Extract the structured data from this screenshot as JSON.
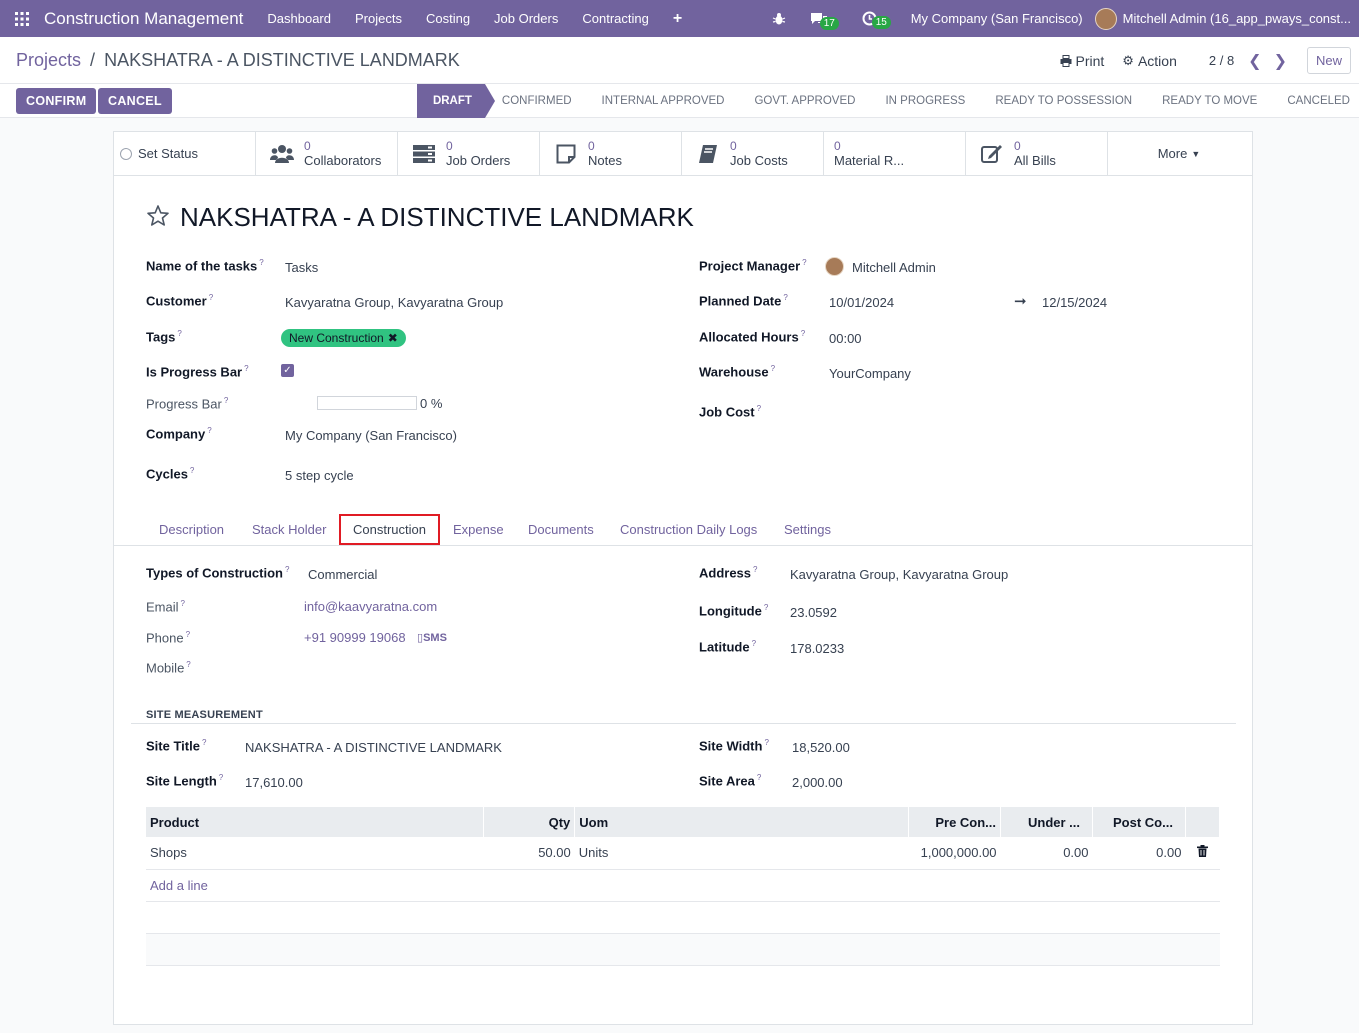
{
  "navbar": {
    "app_name": "Construction Management",
    "menu": [
      "Dashboard",
      "Projects",
      "Costing",
      "Job Orders",
      "Contracting"
    ],
    "messages_count": "17",
    "activities_count": "15",
    "company": "My Company (San Francisco)",
    "user": "Mitchell Admin (16_app_pways_const..."
  },
  "control_panel": {
    "breadcrumb_parent": "Projects",
    "breadcrumb_sep": "/",
    "record_name": "NAKSHATRA - A DISTINCTIVE LANDMARK",
    "print_label": "Print",
    "action_label": "Action",
    "pager": "2 / 8",
    "new_label": "New"
  },
  "statusbar": {
    "confirm_label": "CONFIRM",
    "cancel_label": "CANCEL",
    "stages": [
      "DRAFT",
      "CONFIRMED",
      "INTERNAL APPROVED",
      "GOVT. APPROVED",
      "IN PROGRESS",
      "READY TO POSSESSION",
      "READY TO MOVE",
      "CANCELED"
    ],
    "active_stage": "DRAFT"
  },
  "smart_buttons": {
    "set_status": "Set Status",
    "collaborators": {
      "count": "0",
      "label": "Collaborators"
    },
    "job_orders": {
      "count": "0",
      "label": "Job Orders"
    },
    "notes": {
      "count": "0",
      "label": "Notes"
    },
    "job_costs": {
      "count": "0",
      "label": "Job Costs"
    },
    "material": {
      "count": "0",
      "label": "Material R..."
    },
    "all_bills": {
      "count": "0",
      "label": "All Bills"
    },
    "more": "More"
  },
  "form": {
    "title": "NAKSHATRA - A DISTINCTIVE LANDMARK",
    "labels": {
      "task_name": "Name of the tasks",
      "customer": "Customer",
      "tags": "Tags",
      "is_progress": "Is Progress Bar",
      "progress_bar": "Progress Bar",
      "company": "Company",
      "cycles": "Cycles",
      "project_manager": "Project Manager",
      "planned_date": "Planned Date",
      "allocated_hours": "Allocated Hours",
      "warehouse": "Warehouse",
      "job_cost": "Job Cost"
    },
    "values": {
      "task_name": "Tasks",
      "customer": "Kavyaratna Group, Kavyaratna Group",
      "tag": "New Construction",
      "is_progress": true,
      "progress_percent": 0,
      "progress_text": "0 %",
      "company": "My Company (San Francisco)",
      "cycles": "5 step cycle",
      "project_manager": "Mitchell Admin",
      "planned_start": "10/01/2024",
      "planned_end": "12/15/2024",
      "allocated_hours": "00:00",
      "warehouse": "YourCompany",
      "job_cost": ""
    }
  },
  "tabs": [
    "Description",
    "Stack Holder",
    "Construction",
    "Expense",
    "Documents",
    "Construction Daily Logs",
    "Settings"
  ],
  "active_tab": "Construction",
  "construction": {
    "labels": {
      "types": "Types of Construction",
      "email": "Email",
      "phone": "Phone",
      "mobile": "Mobile",
      "address": "Address",
      "longitude": "Longitude",
      "latitude": "Latitude"
    },
    "values": {
      "types": "Commercial",
      "email": "info@kaavyaratna.com",
      "phone": "+91 90999 19068",
      "sms": "SMS",
      "mobile": "",
      "address": "Kavyaratna Group, Kavyaratna Group",
      "longitude": "23.0592",
      "latitude": "178.0233"
    },
    "site_section": "SITE MEASUREMENT",
    "site_labels": {
      "title": "Site Title",
      "length": "Site Length",
      "width": "Site Width",
      "area": "Site Area"
    },
    "site_values": {
      "title": "NAKSHATRA - A DISTINCTIVE LANDMARK",
      "length": "17,610.00",
      "width": "18,520.00",
      "area": "2,000.00"
    },
    "table": {
      "headers": [
        "Product",
        "Qty",
        "Uom",
        "Pre Con...",
        "Under ...",
        "Post Co..."
      ],
      "rows": [
        [
          "Shops",
          "50.00",
          "Units",
          "1,000,000.00",
          "0.00",
          "0.00"
        ]
      ],
      "add_line": "Add a line"
    }
  }
}
